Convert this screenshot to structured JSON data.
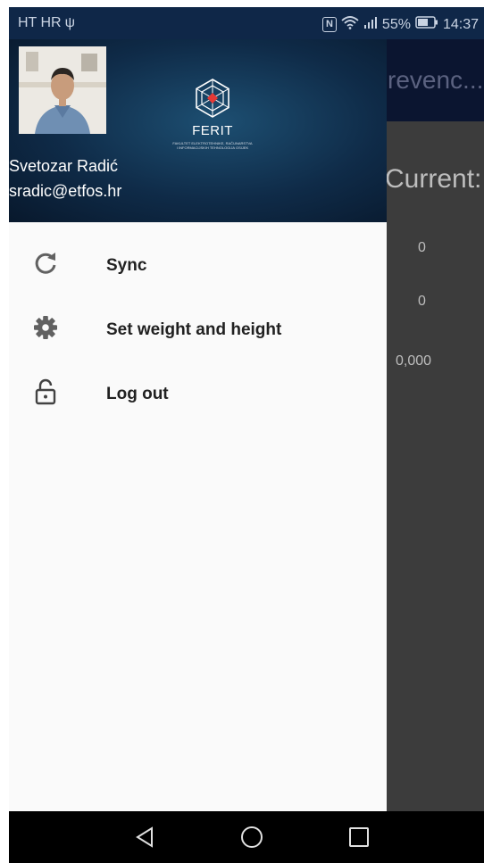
{
  "status_bar": {
    "carrier": "HT HR",
    "usb_icon": "usb-icon",
    "battery": "55%",
    "time": "14:37",
    "icons": [
      "nfc-icon",
      "wifi-icon",
      "signal-icon",
      "battery-icon"
    ]
  },
  "background_app": {
    "toolbar_title": "revenc...",
    "current_label": "Current:",
    "values": [
      "0",
      "0",
      "0,000"
    ]
  },
  "drawer": {
    "header": {
      "user_name": "Svetozar Radić",
      "user_email": "sradic@etfos.hr",
      "logo": {
        "name": "FERIT",
        "subtitle_line1": "FAKULTET ELEKTROTEHNIKE, RAČUNARSTVA",
        "subtitle_line2": "I INFORMACIJSKIH TEHNOLOGIJA OSIJEK"
      }
    },
    "menu": [
      {
        "label": "Sync",
        "icon": "refresh-icon"
      },
      {
        "label": "Set weight and height",
        "icon": "gear-icon"
      },
      {
        "label": "Log out",
        "icon": "unlock-icon"
      }
    ]
  },
  "nav_bar": {
    "buttons": [
      "back-icon",
      "home-icon",
      "recents-icon"
    ]
  },
  "colors": {
    "status_bar": "#0f2748",
    "drawer_bg": "#fafafa",
    "overlay": "#3c3c3c",
    "nav_bar": "#000000"
  }
}
